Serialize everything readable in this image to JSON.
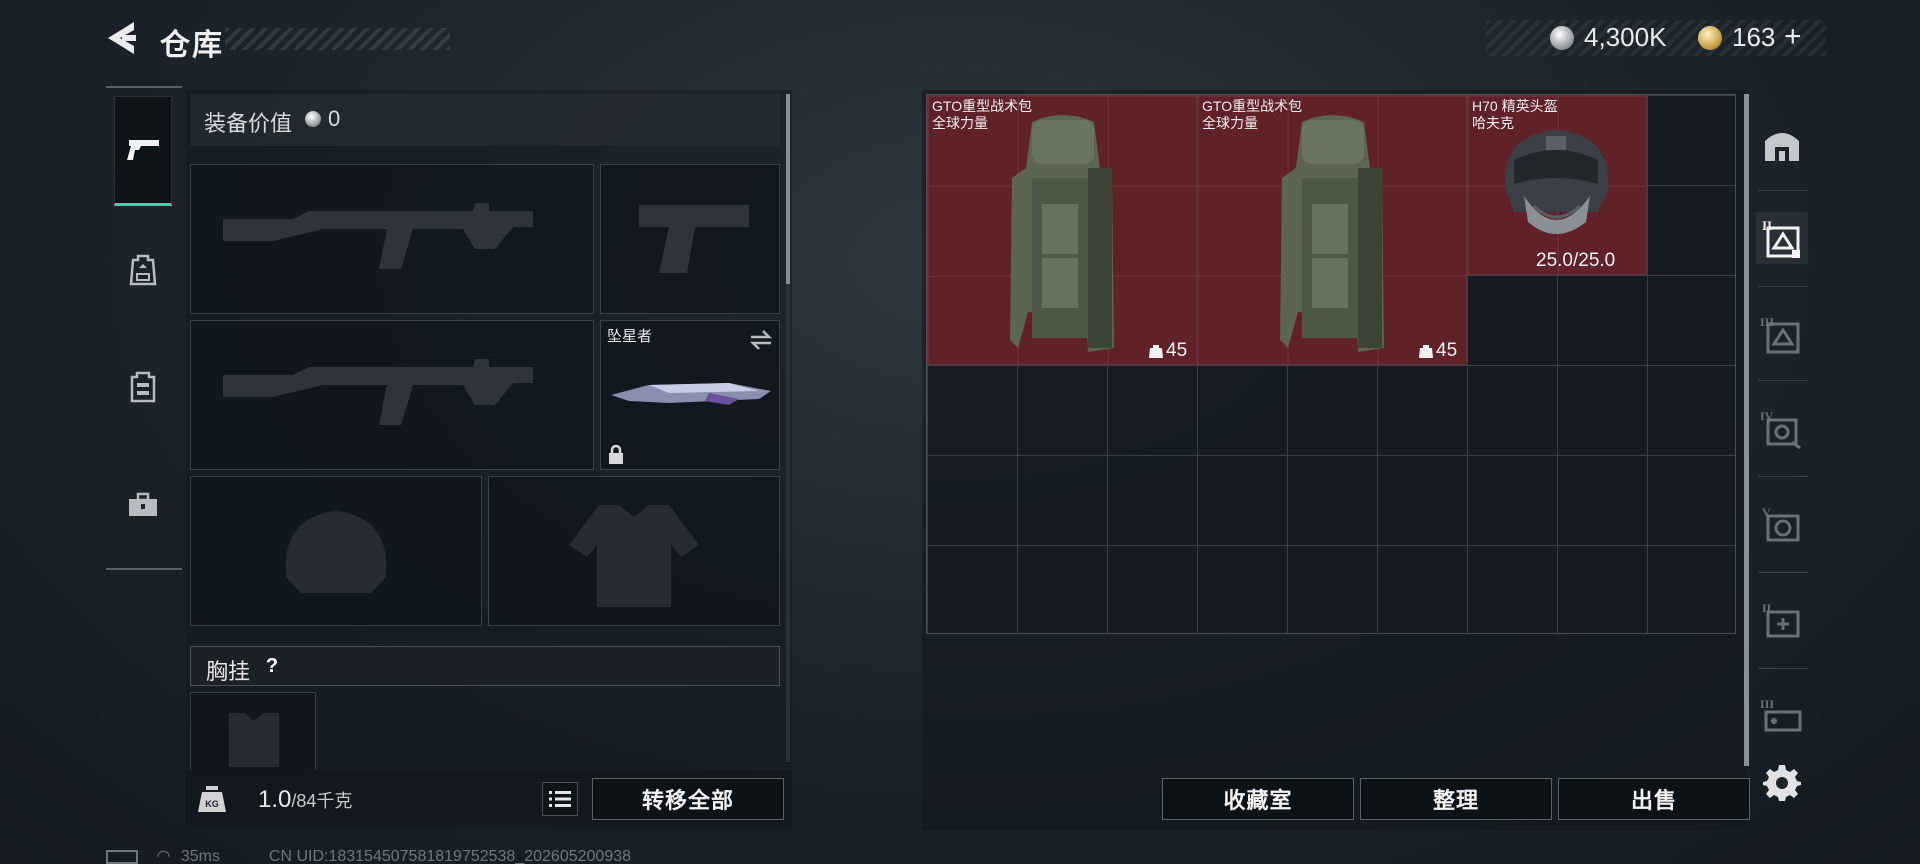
{
  "header": {
    "title": "仓库",
    "silver_amount": "4,300K",
    "gold_amount": "163",
    "gold_add": "+"
  },
  "side_tabs": [
    {
      "name": "weapon-tab",
      "icon": "pistol-icon",
      "active": true
    },
    {
      "name": "bag-tab",
      "icon": "backpack-icon",
      "active": false
    },
    {
      "name": "vest-tab",
      "icon": "vest-icon",
      "active": false
    },
    {
      "name": "case-tab",
      "icon": "toolbox-icon",
      "active": false
    }
  ],
  "equipment": {
    "value_label": "装备价值",
    "value_amount": "0",
    "melee_name": "坠星者",
    "chest_rig_label": "胸挂",
    "help_symbol": "?",
    "weight_current": "1.0",
    "weight_max": "/84千克",
    "transfer_all_label": "转移全部"
  },
  "stash": {
    "items": [
      {
        "name": "GTO重型战术包",
        "subtitle": "全球力量",
        "count": "45",
        "icon": "backpack-icon"
      },
      {
        "name": "GTO重型战术包",
        "subtitle": "全球力量",
        "count": "45",
        "icon": "backpack-icon"
      },
      {
        "name": "H70 精英头盔",
        "subtitle": "哈夫克",
        "durability": "25.0/25.0",
        "icon": "helmet-icon"
      }
    ],
    "buttons": {
      "collection_label": "收藏室",
      "sort_label": "整理",
      "sell_label": "出售"
    }
  },
  "status": {
    "ping": "35ms",
    "uid": "CN UID:183154507581819752538_202605200938"
  },
  "colors": {
    "accent": "#3bd6b0",
    "item_bg": "#76222c",
    "panel_bg": "#141a20"
  }
}
